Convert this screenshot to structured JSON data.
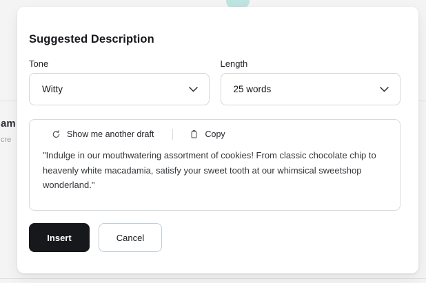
{
  "background": {
    "fragment_text_bold": "am",
    "fragment_text_gray": "cre"
  },
  "modal": {
    "title": "Suggested Description",
    "tone": {
      "label": "Tone",
      "value": "Witty"
    },
    "length": {
      "label": "Length",
      "value": "25 words"
    },
    "draft": {
      "regenerate_label": "Show me another draft",
      "copy_label": "Copy",
      "text": "\"Indulge in our mouthwatering assortment of cookies! From classic chocolate chip to heavenly white macadamia, satisfy your sweet tooth at our whimsical sweetshop wonderland.\""
    },
    "actions": {
      "insert": "Insert",
      "cancel": "Cancel"
    }
  },
  "colors": {
    "accent_teal": "#bee4e1",
    "primary_button": "#17181c",
    "page_background": "#f4f4f4",
    "input_border": "#d6d6d6",
    "cancel_border": "#c3cdd8"
  }
}
